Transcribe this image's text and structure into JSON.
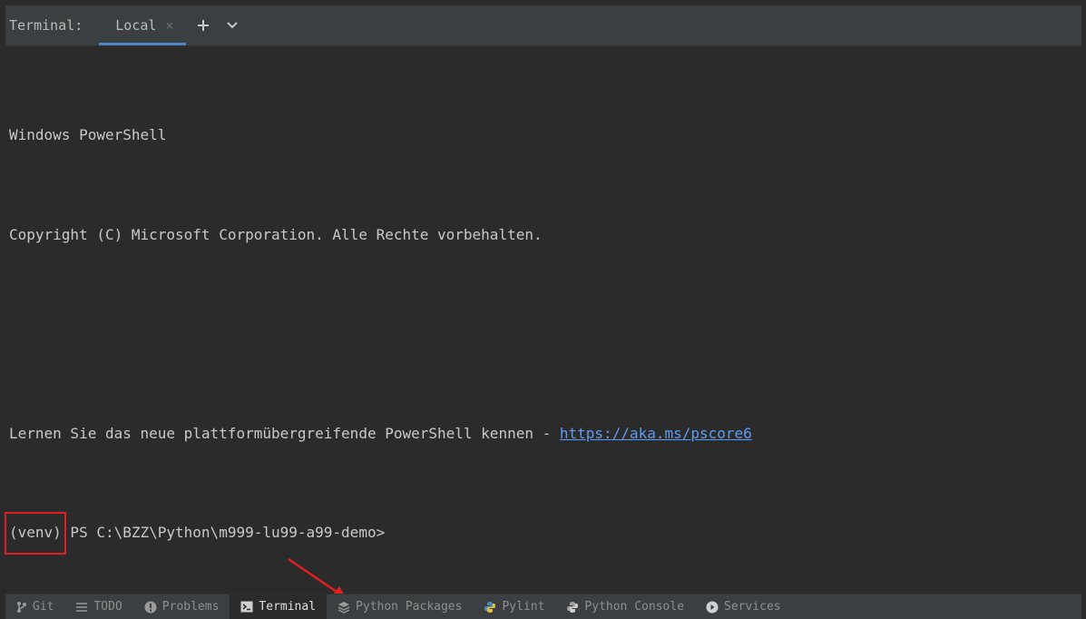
{
  "tabbar": {
    "title": "Terminal:",
    "tab_label": "Local",
    "close_glyph": "×",
    "new_tab_icon": "plus-icon",
    "dropdown_icon": "chevron-down-icon"
  },
  "terminal": {
    "lines": [
      "Windows PowerShell",
      "Copyright (C) Microsoft Corporation. Alle Rechte vorbehalten.",
      "",
      "Lernen Sie das neue plattformübergreifende PowerShell kennen - "
    ],
    "link": "https://aka.ms/pscore6",
    "venv": "(venv)",
    "prompt": " PS C:\\BZZ\\Python\\m999-lu99-a99-demo>"
  },
  "bottom_tabs": [
    {
      "label": "Git",
      "icon": "git-branch-icon"
    },
    {
      "label": "TODO",
      "icon": "list-icon"
    },
    {
      "label": "Problems",
      "icon": "alert-icon"
    },
    {
      "label": "Terminal",
      "icon": "terminal-icon",
      "active": true
    },
    {
      "label": "Python Packages",
      "icon": "layers-icon"
    },
    {
      "label": "Pylint",
      "icon": "python-icon"
    },
    {
      "label": "Python Console",
      "icon": "python-console-icon"
    },
    {
      "label": "Services",
      "icon": "play-circle-icon"
    }
  ],
  "colors": {
    "background": "#2b2b2b",
    "toolbar": "#3c3f41",
    "accent": "#4a88c7",
    "link": "#5e9cf2",
    "highlight_box": "#e02020",
    "arrow": "#e02020"
  }
}
